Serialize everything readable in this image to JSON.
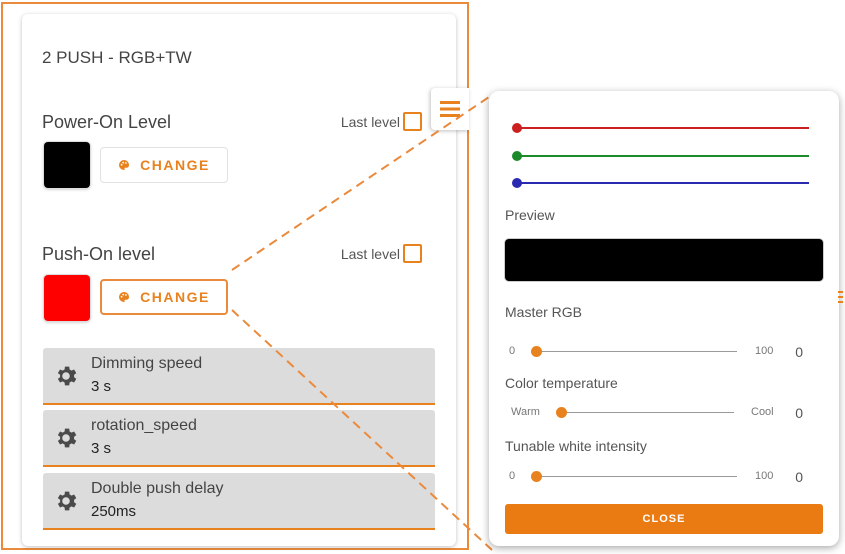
{
  "card": {
    "title": "2 PUSH - RGB+TW",
    "power_on": {
      "label": "Power-On Level",
      "last_level_label": "Last level",
      "swatch_color": "#000000",
      "change_label": "CHANGE"
    },
    "push_on": {
      "label": "Push-On level",
      "last_level_label": "Last level",
      "swatch_color": "#ff0000",
      "change_label": "CHANGE"
    },
    "settings": [
      {
        "label": "Dimming speed",
        "value": "3 s",
        "icon": "gear-icon"
      },
      {
        "label": "rotation_speed",
        "value": "3 s",
        "icon": "gear-icon"
      },
      {
        "label": "Double push delay",
        "value": "250ms",
        "icon": "gear-icon"
      }
    ]
  },
  "menu": {
    "icon": "hamburger-menu-icon"
  },
  "panel": {
    "channels": [
      {
        "name": "red",
        "color": "#cc2020",
        "level": 0
      },
      {
        "name": "green",
        "color": "#1a8a2a",
        "level": 0
      },
      {
        "name": "blue",
        "color": "#2a2ab0",
        "level": 0
      }
    ],
    "preview_label": "Preview",
    "preview_color": "#000000",
    "master_rgb": {
      "label": "Master RGB",
      "min": "0",
      "max": "100",
      "value": "0"
    },
    "color_temperature": {
      "label": "Color temperature",
      "min": "Warm",
      "max": "Cool",
      "value": "0"
    },
    "tunable_white": {
      "label": "Tunable white intensity",
      "min": "0",
      "max": "100",
      "value": "0"
    },
    "close_label": "CLOSE"
  },
  "colors": {
    "accent": "#e8821e",
    "frame": "#ea8a3c",
    "close": "#ea7a12"
  }
}
